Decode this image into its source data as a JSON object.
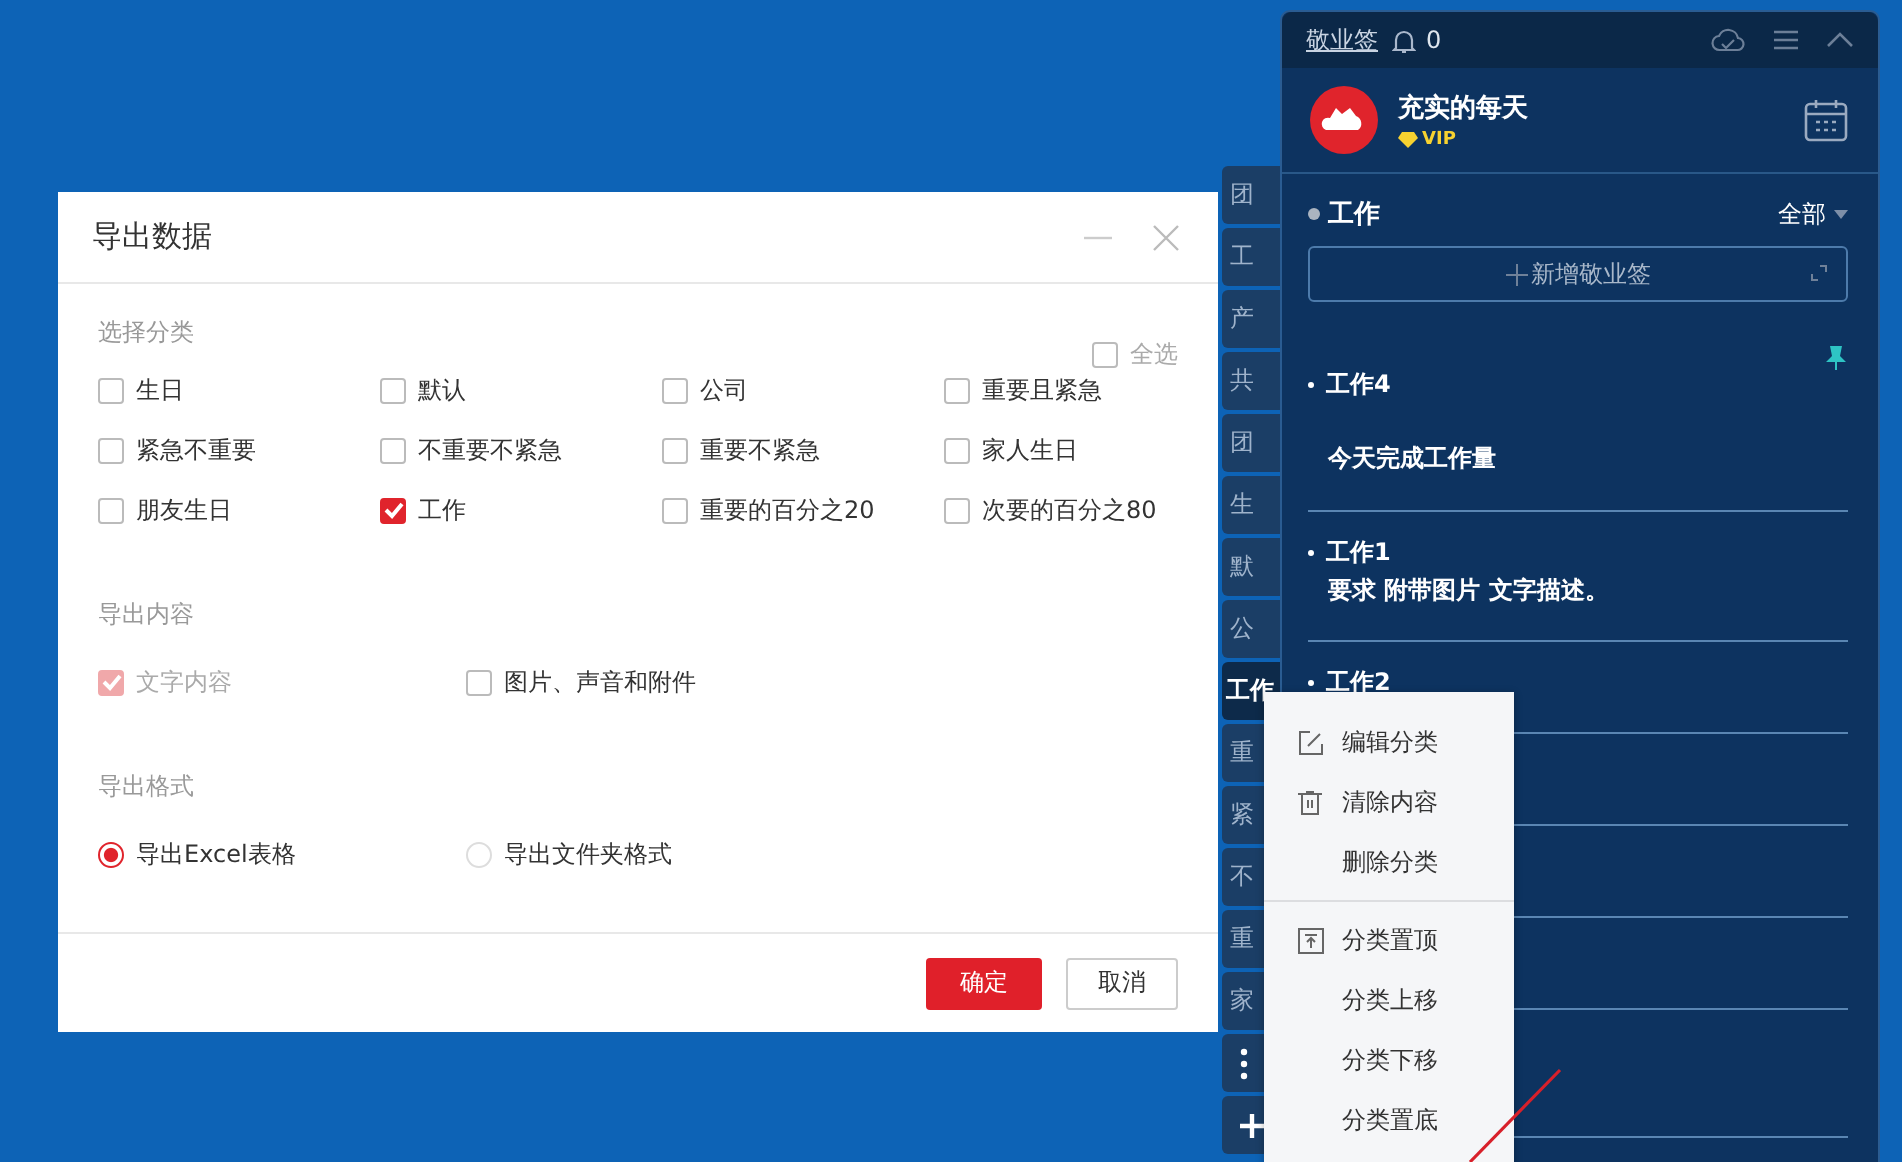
{
  "dialog": {
    "title": "导出数据",
    "category_label": "选择分类",
    "select_all": {
      "label": "全选",
      "checked": false
    },
    "categories": [
      {
        "label": "生日",
        "checked": false
      },
      {
        "label": "默认",
        "checked": false
      },
      {
        "label": "公司",
        "checked": false
      },
      {
        "label": "重要且紧急",
        "checked": false
      },
      {
        "label": "紧急不重要",
        "checked": false
      },
      {
        "label": "不重要不紧急",
        "checked": false
      },
      {
        "label": "重要不紧急",
        "checked": false
      },
      {
        "label": "家人生日",
        "checked": false
      },
      {
        "label": "朋友生日",
        "checked": false
      },
      {
        "label": "工作",
        "checked": true
      },
      {
        "label": "重要的百分之20",
        "checked": false
      },
      {
        "label": "次要的百分之80",
        "checked": false
      }
    ],
    "content_label": "导出内容",
    "content_options": [
      {
        "label": "文字内容",
        "checked": true,
        "disabled": true
      },
      {
        "label": "图片、声音和附件",
        "checked": false,
        "disabled": false
      }
    ],
    "format_label": "导出格式",
    "formats": [
      {
        "label": "导出Excel表格",
        "selected": true
      },
      {
        "label": "导出文件夹格式",
        "selected": false
      }
    ],
    "buttons": [
      {
        "label": "确定",
        "kind": "primary"
      },
      {
        "label": "取消",
        "kind": "secondary"
      }
    ]
  },
  "side_tabs": [
    {
      "label": "团",
      "selected": false
    },
    {
      "label": "工",
      "selected": false
    },
    {
      "label": "产",
      "selected": false
    },
    {
      "label": "共",
      "selected": false
    },
    {
      "label": "团",
      "selected": false
    },
    {
      "label": "生",
      "selected": false
    },
    {
      "label": "默",
      "selected": false
    },
    {
      "label": "公",
      "selected": false
    },
    {
      "label": "工作",
      "selected": true
    },
    {
      "label": "重",
      "selected": false
    },
    {
      "label": "紧",
      "selected": false
    },
    {
      "label": "不",
      "selected": false
    },
    {
      "label": "重",
      "selected": false
    },
    {
      "label": "家",
      "selected": false
    }
  ],
  "panel": {
    "app_name": "敬业签",
    "notifications": "0",
    "user_name": "充实的每天",
    "badge": "VIP",
    "category": "工作",
    "filter": "全部",
    "new_button": "新增敬业签",
    "notes": [
      {
        "title": "工作4",
        "body": "今天完成工作量",
        "pinned": true
      },
      {
        "title": "工作1",
        "body": "要求 附带图片 文字描述。",
        "pinned": false
      },
      {
        "title": "工作2",
        "pinned": false
      }
    ]
  },
  "context_menu": {
    "groups": [
      [
        {
          "label": "编辑分类",
          "kind": "edit"
        },
        {
          "label": "清除内容",
          "kind": "trash"
        },
        {
          "label": "删除分类",
          "kind": "plain"
        }
      ],
      [
        {
          "label": "分类置顶",
          "kind": "to_top"
        },
        {
          "label": "分类上移",
          "kind": "plain"
        },
        {
          "label": "分类下移",
          "kind": "plain"
        },
        {
          "label": "分类置底",
          "kind": "plain"
        }
      ]
    ]
  }
}
